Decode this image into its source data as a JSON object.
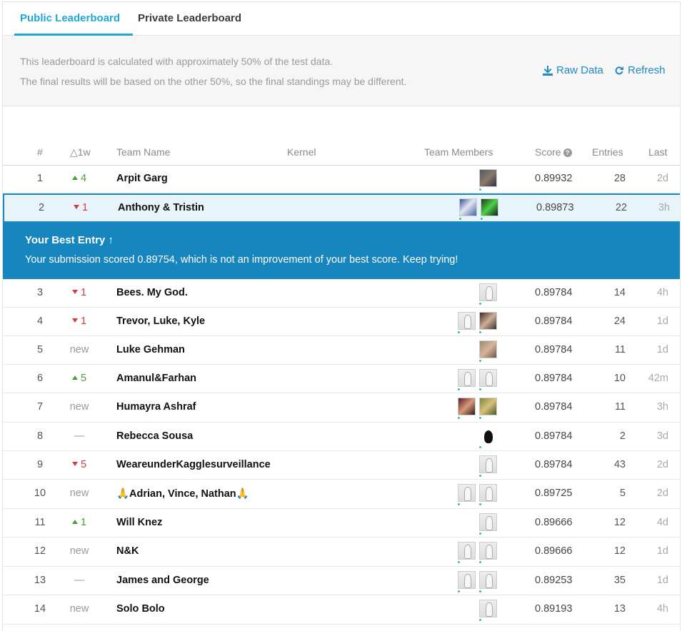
{
  "tabs": [
    {
      "label": "Public Leaderboard",
      "active": true
    },
    {
      "label": "Private Leaderboard",
      "active": false
    }
  ],
  "notice": {
    "line1": "This leaderboard is calculated with approximately 50% of the test data.",
    "line2": "The final results will be based on the other 50%, so the final standings may be different."
  },
  "actions": {
    "raw_data": "Raw Data",
    "refresh": "Refresh"
  },
  "columns": {
    "rank": "#",
    "change": "△1w",
    "team": "Team Name",
    "kernel": "Kernel",
    "members": "Team Members",
    "score": "Score",
    "entries": "Entries",
    "last": "Last"
  },
  "best_entry": {
    "title": "Your Best Entry ↑",
    "message": "Your submission scored 0.89754, which is not an improvement of your best score. Keep trying!"
  },
  "rows": [
    {
      "rank": "1",
      "change": "4",
      "dir": "up",
      "team": "Arpit Garg",
      "score": "0.89932",
      "entries": "28",
      "last": "2d",
      "avatars": [
        "photo1"
      ]
    },
    {
      "rank": "2",
      "change": "1",
      "dir": "down",
      "team": "Anthony & Tristin",
      "score": "0.89873",
      "entries": "22",
      "last": "3h",
      "avatars": [
        "photo2",
        "photo3"
      ]
    },
    {
      "rank": "3",
      "change": "1",
      "dir": "down",
      "team": "Bees. My God.",
      "score": "0.89784",
      "entries": "14",
      "last": "4h",
      "avatars": [
        "goose"
      ]
    },
    {
      "rank": "4",
      "change": "1",
      "dir": "down",
      "team": "Trevor, Luke, Kyle",
      "score": "0.89784",
      "entries": "24",
      "last": "1d",
      "avatars": [
        "goose",
        "photo4"
      ]
    },
    {
      "rank": "5",
      "change": "new",
      "dir": "none",
      "team": "Luke Gehman",
      "score": "0.89784",
      "entries": "11",
      "last": "1d",
      "avatars": [
        "photo5"
      ]
    },
    {
      "rank": "6",
      "change": "5",
      "dir": "up",
      "team": "Amanul&Farhan",
      "score": "0.89784",
      "entries": "10",
      "last": "42m",
      "avatars": [
        "goose",
        "goose"
      ]
    },
    {
      "rank": "7",
      "change": "new",
      "dir": "none",
      "team": "Humayra Ashraf",
      "score": "0.89784",
      "entries": "11",
      "last": "3h",
      "avatars": [
        "photo6",
        "photo7"
      ]
    },
    {
      "rank": "8",
      "change": "—",
      "dir": "none",
      "team": "Rebecca Sousa",
      "score": "0.89784",
      "entries": "2",
      "last": "3d",
      "avatars": [
        "cat"
      ]
    },
    {
      "rank": "9",
      "change": "5",
      "dir": "down",
      "team": "WeareunderKagglesurveillance",
      "score": "0.89784",
      "entries": "43",
      "last": "2d",
      "avatars": [
        "goose"
      ]
    },
    {
      "rank": "10",
      "change": "new",
      "dir": "none",
      "team": "🙏Adrian, Vince, Nathan🙏",
      "score": "0.89725",
      "entries": "5",
      "last": "2d",
      "avatars": [
        "goose",
        "goose"
      ]
    },
    {
      "rank": "11",
      "change": "1",
      "dir": "up",
      "team": "Will Knez",
      "score": "0.89666",
      "entries": "12",
      "last": "4d",
      "avatars": [
        "goose"
      ]
    },
    {
      "rank": "12",
      "change": "new",
      "dir": "none",
      "team": "N&K",
      "score": "0.89666",
      "entries": "12",
      "last": "1d",
      "avatars": [
        "goose",
        "goose"
      ]
    },
    {
      "rank": "13",
      "change": "—",
      "dir": "none",
      "team": "James and George",
      "score": "0.89253",
      "entries": "35",
      "last": "1d",
      "avatars": [
        "goose",
        "goose"
      ]
    },
    {
      "rank": "14",
      "change": "new",
      "dir": "none",
      "team": "Solo Bolo",
      "score": "0.89193",
      "entries": "13",
      "last": "4h",
      "avatars": [
        "goose"
      ]
    }
  ]
}
